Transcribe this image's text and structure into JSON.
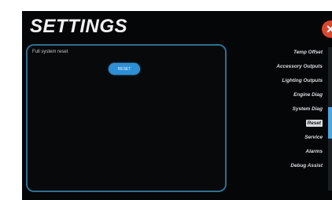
{
  "header": {
    "title": "SETTINGS",
    "close_glyph": "✕"
  },
  "panel": {
    "label": "Full system reset",
    "button_label": "RESET"
  },
  "menu": {
    "items": [
      {
        "label": "Temp Offset",
        "selected": false
      },
      {
        "label": "Accessory Outputs",
        "selected": false
      },
      {
        "label": "Lighting Outputs",
        "selected": false
      },
      {
        "label": "Engine Diag",
        "selected": false
      },
      {
        "label": "System Diag",
        "selected": false
      },
      {
        "label": "Reset",
        "selected": true
      },
      {
        "label": "Service",
        "selected": false
      },
      {
        "label": "Alarms",
        "selected": false
      },
      {
        "label": "Debug Assist",
        "selected": false
      }
    ]
  },
  "colors": {
    "background": "#050607",
    "panel_border": "#2f6f8f",
    "accent_button": "#2d8fd6",
    "close_button": "#d8472f",
    "scroll_thumb": "#4fa4e0"
  },
  "icons": {
    "close": "close-icon"
  }
}
